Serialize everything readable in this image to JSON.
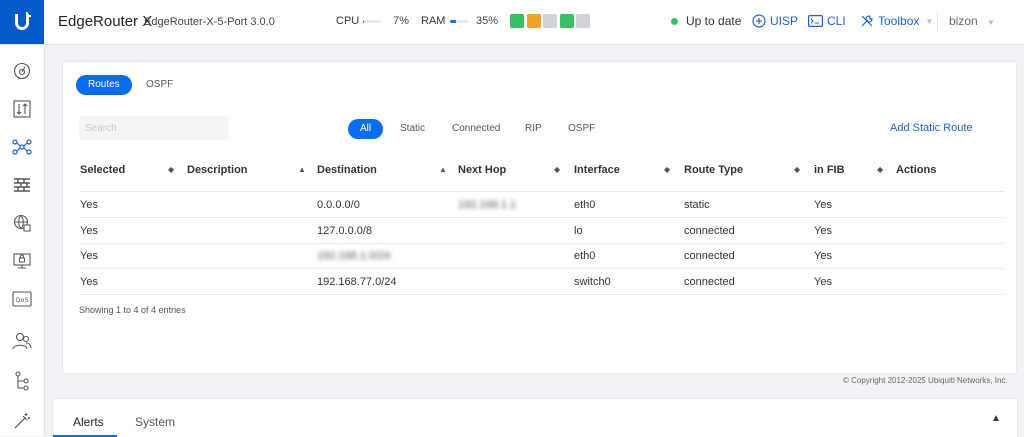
{
  "header": {
    "product_name": "EdgeRouter X",
    "product_model": "EdgeRouter-X-5-Port 3.0.0",
    "cpu_label": "CPU",
    "cpu_pct": "7%",
    "cpu_fraction": 0.07,
    "ram_label": "RAM",
    "ram_pct": "35%",
    "ram_fraction": 0.35,
    "ports": [
      {
        "color": "#3bbf65"
      },
      {
        "color": "#f0a12a"
      },
      {
        "color": "#cfd2d6"
      },
      {
        "color": "#3bbf65"
      },
      {
        "color": "#cfd2d6"
      }
    ],
    "status": "Up to date",
    "uisp_label": "UISP",
    "cli_label": "CLI",
    "toolbox_label": "Toolbox",
    "user": "bizon"
  },
  "sidebar": {
    "icons": [
      "dashboard-icon",
      "routing-icon",
      "network-icon",
      "firewall-icon",
      "services-icon",
      "vpn-icon",
      "qos-icon",
      "users-icon",
      "topology-icon",
      "wizard-icon"
    ]
  },
  "tabs": {
    "routes": "Routes",
    "ospf": "OSPF"
  },
  "search": {
    "placeholder": "Search"
  },
  "filters": {
    "all": "All",
    "static": "Static",
    "connected": "Connected",
    "rip": "RIP",
    "ospf": "OSPF"
  },
  "add_static_route": "Add Static Route",
  "table": {
    "headers": {
      "selected": "Selected",
      "description": "Description",
      "destination": "Destination",
      "next_hop": "Next Hop",
      "interface": "Interface",
      "route_type": "Route Type",
      "in_fib": "in FIB",
      "actions": "Actions"
    },
    "rows": [
      {
        "selected": "Yes",
        "description": "",
        "destination": "0.0.0.0/0",
        "next_hop": "192.168.1.1",
        "interface": "eth0",
        "route_type": "static",
        "in_fib": "Yes"
      },
      {
        "selected": "Yes",
        "description": "",
        "destination": "127.0.0.0/8",
        "next_hop": "",
        "interface": "lo",
        "route_type": "connected",
        "in_fib": "Yes"
      },
      {
        "selected": "Yes",
        "description": "",
        "destination": "192.168.1.0/24",
        "next_hop": "",
        "interface": "eth0",
        "route_type": "connected",
        "in_fib": "Yes"
      },
      {
        "selected": "Yes",
        "description": "",
        "destination": "192.168.77.0/24",
        "next_hop": "",
        "interface": "switch0",
        "route_type": "connected",
        "in_fib": "Yes"
      }
    ],
    "entries": "Showing 1 to 4 of 4 entries"
  },
  "copyright": "© Copyright 2012-2025 Ubiquiti Networks, Inc.",
  "bottom_tabs": {
    "alerts": "Alerts",
    "system": "System"
  }
}
